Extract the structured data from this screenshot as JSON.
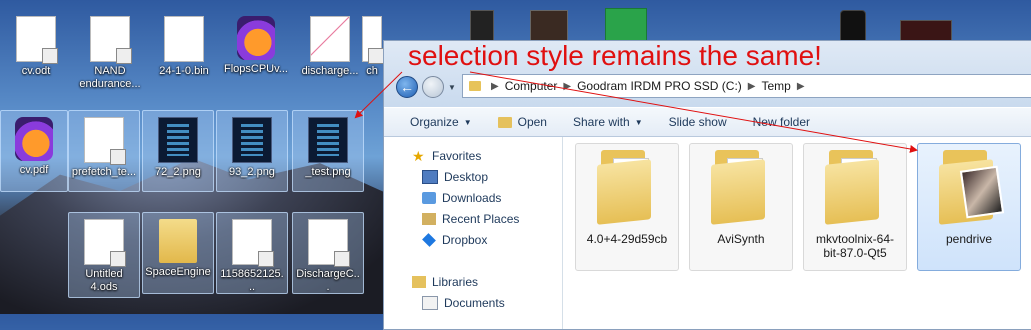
{
  "desktop": {
    "icons": [
      {
        "label": "cv.odt"
      },
      {
        "label": "NAND endurance..."
      },
      {
        "label": "24-1-0.bin"
      },
      {
        "label": "FlopsCPUv..."
      },
      {
        "label": "discharge..."
      },
      {
        "label": "ch"
      },
      {
        "label": "cv.pdf"
      },
      {
        "label": "prefetch_te..."
      },
      {
        "label": "72_2.png"
      },
      {
        "label": "93_2.png"
      },
      {
        "label": "_test.png"
      },
      {
        "label": "Untitled 4.ods"
      },
      {
        "label": "SpaceEngine"
      },
      {
        "label": "1158652125..."
      },
      {
        "label": "DischargeC..."
      }
    ]
  },
  "annotation": {
    "text": "selection style remains the same!",
    "color": "#e01010"
  },
  "explorer": {
    "breadcrumb": [
      "Computer",
      "Goodram IRDM PRO SSD (C:)",
      "Temp"
    ],
    "toolbar": {
      "organize": "Organize",
      "open": "Open",
      "share_with": "Share with",
      "slide_show": "Slide show",
      "new_folder": "New folder"
    },
    "nav": {
      "favorites": "Favorites",
      "desktop": "Desktop",
      "downloads": "Downloads",
      "recent_places": "Recent Places",
      "dropbox": "Dropbox",
      "libraries": "Libraries",
      "documents": "Documents"
    },
    "folders": [
      {
        "label": "4.0+4-29d59cb"
      },
      {
        "label": "AviSynth"
      },
      {
        "label": "mkvtoolnix-64-bit-87.0-Qt5"
      },
      {
        "label": "pendrive"
      }
    ]
  }
}
